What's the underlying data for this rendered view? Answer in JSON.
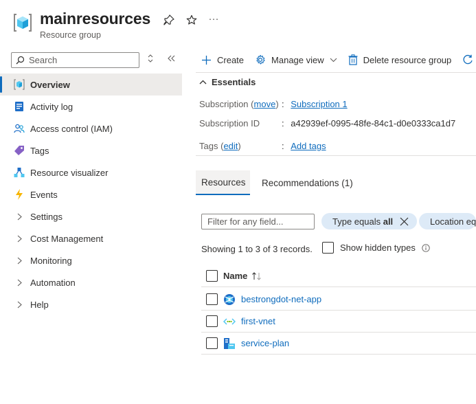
{
  "header": {
    "title": "mainresources",
    "subtitle": "Resource group",
    "more_label": "···"
  },
  "sidebar": {
    "search_placeholder": "Search",
    "items": [
      {
        "label": "Overview",
        "icon": "resource-group-icon",
        "active": true
      },
      {
        "label": "Activity log",
        "icon": "activity-log-icon"
      },
      {
        "label": "Access control (IAM)",
        "icon": "iam-icon"
      },
      {
        "label": "Tags",
        "icon": "tag-icon"
      },
      {
        "label": "Resource visualizer",
        "icon": "visualizer-icon"
      },
      {
        "label": "Events",
        "icon": "lightning-icon"
      },
      {
        "label": "Settings",
        "expandable": true
      },
      {
        "label": "Cost Management",
        "expandable": true
      },
      {
        "label": "Monitoring",
        "expandable": true
      },
      {
        "label": "Automation",
        "expandable": true
      },
      {
        "label": "Help",
        "expandable": true
      }
    ]
  },
  "toolbar": {
    "create": "Create",
    "manage_view": "Manage view",
    "delete": "Delete resource group"
  },
  "essentials": {
    "heading": "Essentials",
    "subscription_label": "Subscription",
    "subscription_open_paren": "(",
    "subscription_move": "move",
    "subscription_close_paren": ")",
    "subscription_value": "Subscription 1",
    "subscription_id_label": "Subscription ID",
    "subscription_id_value": "a42939ef-0995-48fe-84c1-d0e0333ca1d7",
    "tags_label": "Tags",
    "tags_open_paren": "(",
    "tags_edit": "edit",
    "tags_close_paren": ")",
    "tags_value": "Add tags",
    "separator": ":"
  },
  "tabs": [
    {
      "label": "Resources",
      "active": true
    },
    {
      "label": "Recommendations (1)"
    }
  ],
  "filters": {
    "placeholder": "Filter for any field...",
    "type_prefix": "Type equals ",
    "type_value": "all",
    "location_pill": "Location eq"
  },
  "records": "Showing 1 to 3 of 3 records.",
  "show_hidden_types": "Show hidden types",
  "table": {
    "name_header": "Name",
    "rows": [
      {
        "name": "bestrongdot-net-app",
        "icon": "web-app-icon"
      },
      {
        "name": "first-vnet",
        "icon": "vnet-icon"
      },
      {
        "name": "service-plan",
        "icon": "app-service-plan-icon"
      }
    ]
  },
  "colors": {
    "accent": "#0f6cbd",
    "active_bg": "#edebe9",
    "pill_bg": "#ddeaf7"
  }
}
